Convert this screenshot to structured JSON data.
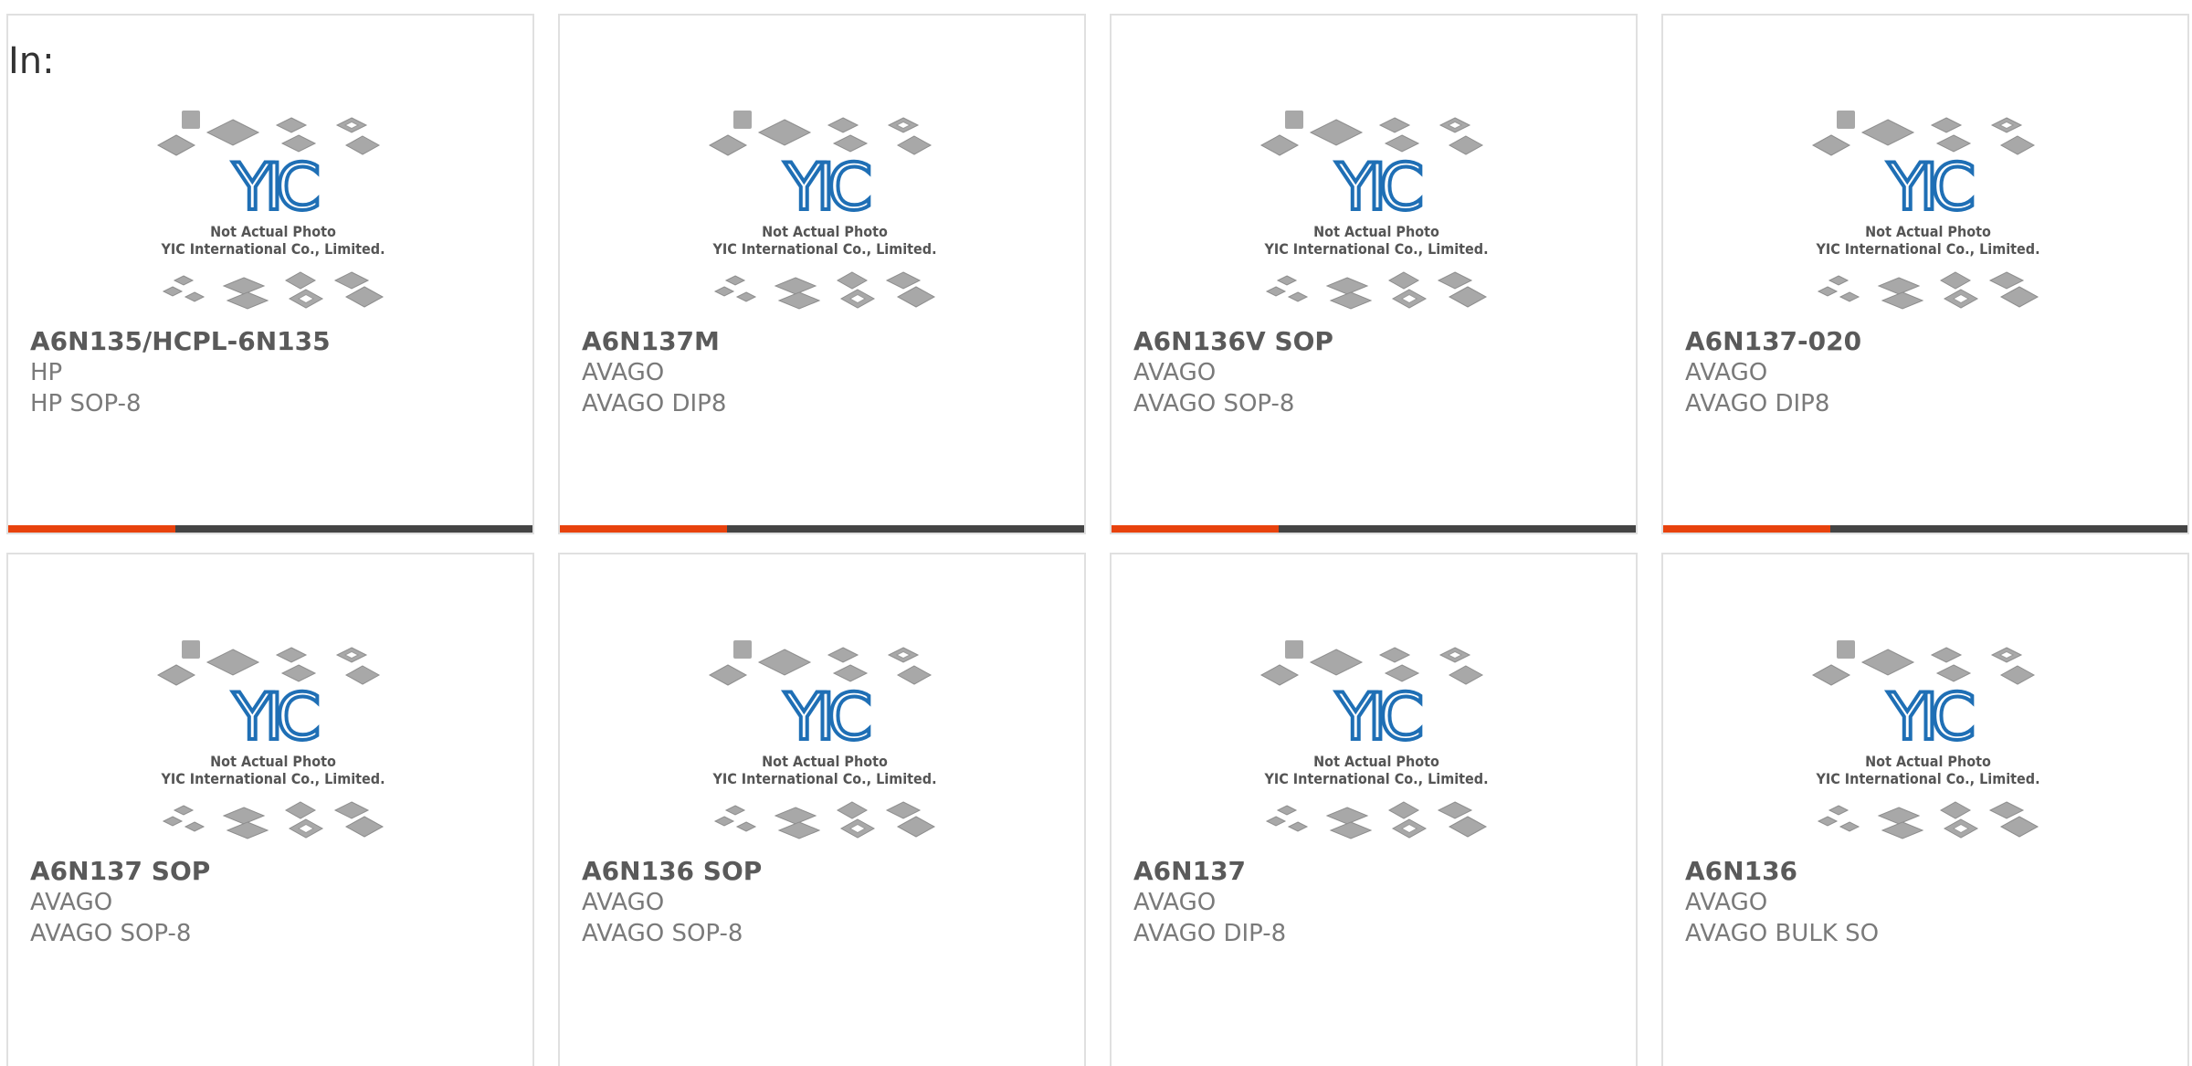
{
  "header_prefix": "In:",
  "photo_caption_line1": "Not Actual Photo",
  "photo_caption_line2": "YIC International Co., Limited.",
  "logo_text": "YIC",
  "colors": {
    "accent": "#e8420d",
    "bar_dark": "#444444",
    "logo_blue": "#1f6fb5",
    "chip_gray": "#a8a8a8"
  },
  "products": [
    {
      "part": "A6N135/HCPL-6N135",
      "brand": "HP",
      "package": "HP SOP-8"
    },
    {
      "part": "A6N137M",
      "brand": "AVAGO",
      "package": "AVAGO DIP8"
    },
    {
      "part": "A6N136V SOP",
      "brand": "AVAGO",
      "package": "AVAGO SOP-8"
    },
    {
      "part": "A6N137-020",
      "brand": "AVAGO",
      "package": "AVAGO DIP8"
    },
    {
      "part": "A6N137 SOP",
      "brand": "AVAGO",
      "package": "AVAGO SOP-8"
    },
    {
      "part": "A6N136 SOP",
      "brand": "AVAGO",
      "package": "AVAGO SOP-8"
    },
    {
      "part": "A6N137",
      "brand": "AVAGO",
      "package": "AVAGO DIP-8"
    },
    {
      "part": "A6N136",
      "brand": "AVAGO",
      "package": "AVAGO BULK SO"
    }
  ]
}
